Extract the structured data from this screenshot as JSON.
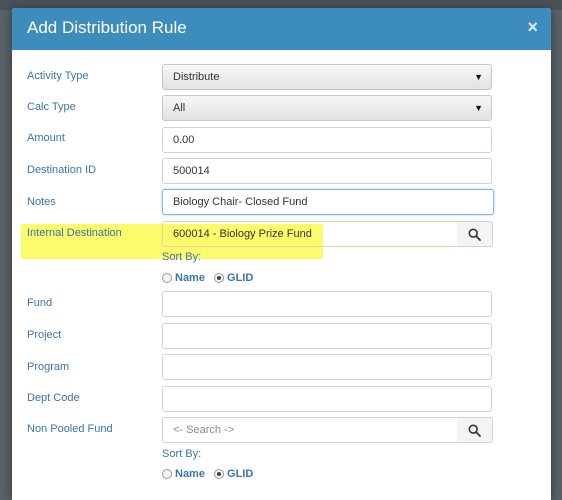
{
  "dialog": {
    "title": "Add Distribution Rule",
    "close_glyph": "×"
  },
  "fields": {
    "activity_type": {
      "label": "Activity Type",
      "value": "Distribute"
    },
    "calc_type": {
      "label": "Calc Type",
      "value": "All"
    },
    "amount": {
      "label": "Amount",
      "value": "0.00"
    },
    "destination_id": {
      "label": "Destination ID",
      "value": "500014"
    },
    "notes": {
      "label": "Notes",
      "value": "Biology Chair- Closed Fund"
    },
    "internal_destination": {
      "label": "Internal Destination",
      "value": "600014 - Biology Prize Fund"
    },
    "fund": {
      "label": "Fund",
      "value": ""
    },
    "project": {
      "label": "Project",
      "value": ""
    },
    "program": {
      "label": "Program",
      "value": ""
    },
    "dept_code": {
      "label": "Dept Code",
      "value": ""
    },
    "non_pooled_fund": {
      "label": "Non Pooled Fund",
      "placeholder": "<- Search ->"
    }
  },
  "sort_by": {
    "label": "Sort By:",
    "options": [
      "Name",
      "GLID"
    ],
    "selected": "GLID"
  },
  "icons": {
    "dropdown": "caret-down-icon",
    "search": "search-icon",
    "close": "close-icon"
  },
  "colors": {
    "header": "#3c8dbc",
    "label": "#3c73a8",
    "highlight": "#fbfb6c"
  }
}
